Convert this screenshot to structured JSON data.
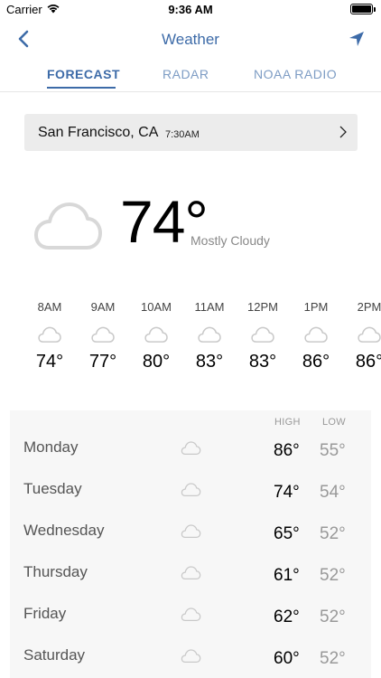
{
  "status_bar": {
    "carrier": "Carrier",
    "time": "9:36 AM",
    "battery_level": 1.0
  },
  "nav": {
    "title": "Weather",
    "back_icon": "chevron-left-icon",
    "location_icon": "location-arrow-icon"
  },
  "tabs": [
    {
      "label": "FORECAST",
      "active": true
    },
    {
      "label": "RADAR",
      "active": false
    },
    {
      "label": "NOAA RADIO",
      "active": false
    }
  ],
  "location": {
    "city": "San Francisco, CA",
    "time": "7:30AM"
  },
  "current": {
    "temp": "74°",
    "condition": "Mostly Cloudy",
    "icon": "cloud-icon"
  },
  "hourly": [
    {
      "time": "8AM",
      "temp": "74°",
      "icon": "cloud-icon"
    },
    {
      "time": "9AM",
      "temp": "77°",
      "icon": "cloud-icon"
    },
    {
      "time": "10AM",
      "temp": "80°",
      "icon": "cloud-icon"
    },
    {
      "time": "11AM",
      "temp": "83°",
      "icon": "cloud-icon"
    },
    {
      "time": "12PM",
      "temp": "83°",
      "icon": "cloud-icon"
    },
    {
      "time": "1PM",
      "temp": "86°",
      "icon": "cloud-icon"
    },
    {
      "time": "2PM",
      "temp": "86°",
      "icon": "cloud-icon"
    }
  ],
  "daily": {
    "high_label": "HIGH",
    "low_label": "LOW",
    "days": [
      {
        "day": "Monday",
        "high": "86°",
        "low": "55°",
        "icon": "cloud-icon"
      },
      {
        "day": "Tuesday",
        "high": "74°",
        "low": "54°",
        "icon": "cloud-icon"
      },
      {
        "day": "Wednesday",
        "high": "65°",
        "low": "52°",
        "icon": "cloud-icon"
      },
      {
        "day": "Thursday",
        "high": "61°",
        "low": "52°",
        "icon": "cloud-icon"
      },
      {
        "day": "Friday",
        "high": "62°",
        "low": "52°",
        "icon": "cloud-icon"
      },
      {
        "day": "Saturday",
        "high": "60°",
        "low": "52°",
        "icon": "cloud-icon"
      }
    ]
  },
  "colors": {
    "accent": "#3d6ba8",
    "tab_inactive": "#7d9cc4",
    "secondary_text": "#999999",
    "panel_bg": "#f7f7f7"
  }
}
